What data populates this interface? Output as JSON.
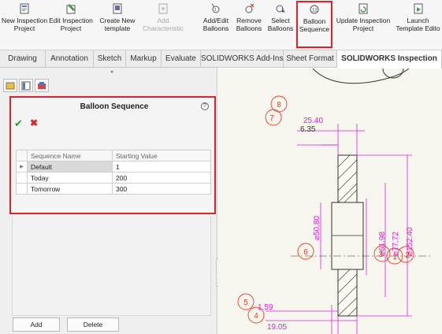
{
  "ribbon": {
    "buttons": [
      {
        "name": "new-inspection-project-button",
        "line1": "New Inspection",
        "line2": "Project",
        "icon": "new-inspection-icon"
      },
      {
        "name": "edit-inspection-project-button",
        "line1": "Edit Inspection",
        "line2": "Project",
        "icon": "edit-inspection-icon"
      },
      {
        "name": "create-new-template-button",
        "line1": "Create New",
        "line2": "template",
        "icon": "template-icon"
      },
      {
        "name": "add-characteristic-button",
        "line1": "Add",
        "line2": "Characteristic",
        "icon": "add-characteristic-icon"
      },
      {
        "name": "add-edit-balloons-button",
        "line1": "Add/Edit",
        "line2": "Balloons",
        "icon": "add-balloon-icon"
      },
      {
        "name": "remove-balloons-button",
        "line1": "Remove",
        "line2": "Balloons",
        "icon": "remove-balloon-icon"
      },
      {
        "name": "select-balloons-button",
        "line1": "Select",
        "line2": "Balloons",
        "icon": "select-balloon-icon"
      },
      {
        "name": "balloon-sequence-button",
        "line1": "Balloon",
        "line2": "Sequence",
        "icon": "balloon-sequence-icon"
      },
      {
        "name": "update-inspection-project-button",
        "line1": "Update Inspection",
        "line2": "Project",
        "icon": "update-inspection-icon"
      },
      {
        "name": "launch-template-editor-button",
        "line1": "Launch",
        "line2": "Template Edito",
        "icon": "launch-editor-icon"
      }
    ]
  },
  "tabs": [
    "Drawing",
    "Annotation",
    "Sketch",
    "Markup",
    "Evaluate",
    "SOLIDWORKS Add-Ins",
    "Sheet Format",
    "SOLIDWORKS Inspection"
  ],
  "panel": {
    "title": "Balloon Sequence",
    "help": "?",
    "ok": "✔",
    "cancel": "✖",
    "columns": [
      "Sequence Name",
      "Starting Value"
    ],
    "rows": [
      {
        "name": "Default",
        "value": "1",
        "selected": true
      },
      {
        "name": "Today",
        "value": "200",
        "selected": false
      },
      {
        "name": "Tomorrow",
        "value": "300",
        "selected": false
      }
    ],
    "add_label": "Add",
    "delete_label": "Delete"
  },
  "drawing": {
    "balloons": [
      "8",
      "7",
      "6",
      "3",
      "1",
      "2",
      "5",
      "4"
    ],
    "dimensions": [
      "25.40",
      "6.35",
      "⌀50.80",
      "⌀61.98",
      "⌀77.72",
      "⌀152.40",
      "1.59",
      "19.05"
    ]
  },
  "colors": {
    "highlight": "#e0202a",
    "dimension": "#e020d8",
    "balloon": "#e8402a"
  }
}
